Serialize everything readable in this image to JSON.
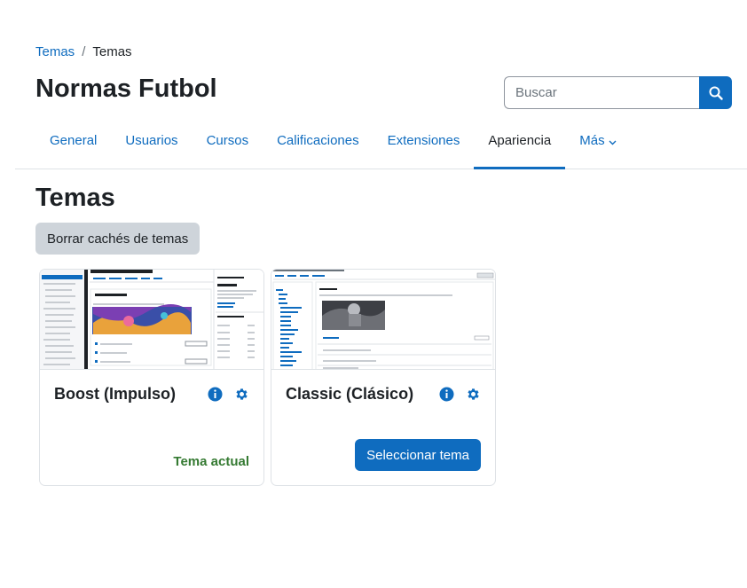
{
  "breadcrumb": {
    "parent": "Temas",
    "separator": "/",
    "current": "Temas"
  },
  "page_title": "Normas Futbol",
  "search": {
    "placeholder": "Buscar",
    "value": ""
  },
  "nav": {
    "tabs": [
      {
        "label": "General"
      },
      {
        "label": "Usuarios"
      },
      {
        "label": "Cursos"
      },
      {
        "label": "Calificaciones"
      },
      {
        "label": "Extensiones"
      },
      {
        "label": "Apariencia",
        "active": true
      },
      {
        "label": "Más",
        "dropdown": true
      }
    ]
  },
  "section_title": "Temas",
  "clear_cache_label": "Borrar cachés de temas",
  "themes": [
    {
      "name": "Boost (Impulso)",
      "status": "Tema actual",
      "icons": [
        "info-icon",
        "gear-icon"
      ]
    },
    {
      "name": "Classic (Clásico)",
      "action": "Seleccionar tema",
      "icons": [
        "info-icon",
        "gear-icon"
      ]
    }
  ],
  "colors": {
    "primary": "#0f6cbf",
    "success": "#357a32",
    "secondary": "#ced4da",
    "text": "#1d2125"
  }
}
